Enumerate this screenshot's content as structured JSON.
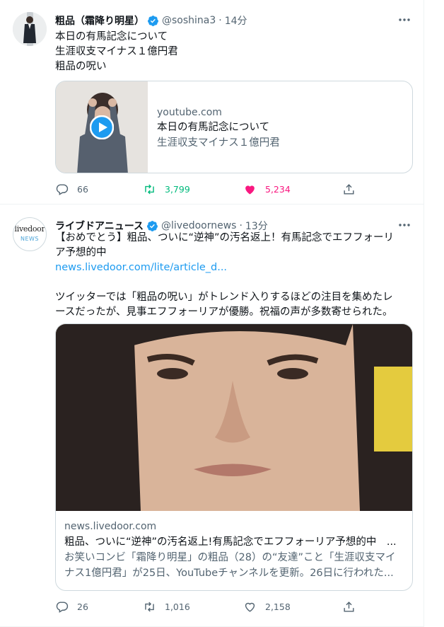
{
  "tweets": [
    {
      "name": "粗品（霜降り明星）",
      "handle": "@soshina3",
      "time": "14分",
      "text_lines": [
        "本日の有馬記念について",
        "生涯収支マイナス１億円君",
        "粗品の呪い"
      ],
      "card": {
        "domain": "youtube.com",
        "title": "本日の有馬記念について",
        "description": "生涯収支マイナス１億円君"
      },
      "actions": {
        "replies": "66",
        "retweets": "3,799",
        "likes": "5,234"
      }
    },
    {
      "name": "ライブドアニュース",
      "handle": "@livedoornews",
      "time": "13分",
      "avatar_logo_top": "livedoor",
      "avatar_logo_bottom": "NEWS",
      "text_lines": [
        "【おめでとう】粗品、ついに“逆神”の汚名返上！有馬記念でエフフォーリ",
        "ア予想的中"
      ],
      "link": "news.livedoor.com/lite/article_d...",
      "text_lines_2": [
        "ツイッターでは「粗品の呪い」がトレンド入りするほどの注目を集めたレ",
        "ースだったが、見事エフフォーリアが優勝。祝福の声が多数寄せられた。"
      ],
      "card": {
        "domain": "news.livedoor.com",
        "title": "粗品、ついに“逆神”の汚名返上!有馬記念でエフフォーリア予想的中　...",
        "description_lines": [
          "お笑いコンビ「霜降り明星」の粗品（28）の“友達”こと「生涯収支マイ",
          "ナス1億円君」が25日、YouTubeチャンネルを更新。26日に行われた..."
        ]
      },
      "actions": {
        "replies": "26",
        "retweets": "1,016",
        "likes": "2,158"
      }
    }
  ],
  "colors": {
    "blue": "#1d9bf0",
    "green": "#00ba7c",
    "pink": "#f91880",
    "gray": "#536471"
  },
  "icons": [
    "verified-badge-icon",
    "more-icon",
    "reply-icon",
    "retweet-icon",
    "like-icon",
    "share-icon",
    "play-icon"
  ]
}
